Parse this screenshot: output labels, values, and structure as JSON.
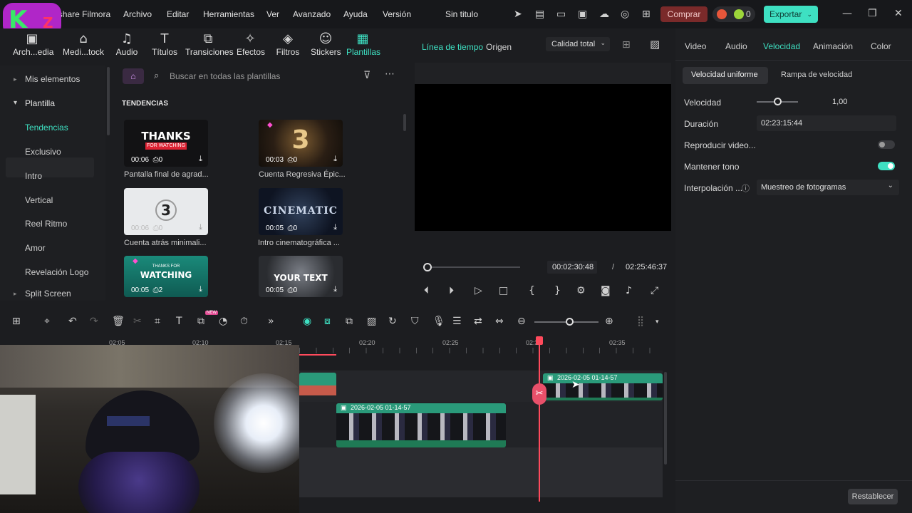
{
  "app": {
    "name": "Wondershare Filmora",
    "project_title": "Sin titulo"
  },
  "menu": [
    "Archivo",
    "Editar",
    "Herramientas",
    "Ver",
    "Avanzado",
    "Ayuda",
    "Versión"
  ],
  "header": {
    "buy_label": "Comprar",
    "credits": "0",
    "export_label": "Exportar"
  },
  "toolbar": [
    {
      "label": "Arch...edia",
      "icon": "media-icon"
    },
    {
      "label": "Medi...tock",
      "icon": "stock-icon"
    },
    {
      "label": "Audio",
      "icon": "audio-icon"
    },
    {
      "label": "Títulos",
      "icon": "titles-icon"
    },
    {
      "label": "Transiciones",
      "icon": "transitions-icon"
    },
    {
      "label": "Efectos",
      "icon": "effects-icon"
    },
    {
      "label": "Filtros",
      "icon": "filters-icon"
    },
    {
      "label": "Stickers",
      "icon": "stickers-icon"
    },
    {
      "label": "Plantillas",
      "icon": "templates-icon"
    }
  ],
  "sidebar": {
    "items": [
      "Mis elementos",
      "Plantilla",
      "Tendencias",
      "Exclusivo",
      "Intro",
      "Vertical",
      "Reel Ritmo",
      "Amor",
      "Revelación Logo",
      "Split Screen"
    ]
  },
  "search": {
    "placeholder": "Buscar en todas las plantillas"
  },
  "section_title": "TENDENCIAS",
  "templates": [
    {
      "caption": "Pantalla final de agrad...",
      "duration": "00:06",
      "count": "0",
      "thumb_text": "THANKS",
      "thumb_sub": "FOR WATCHING"
    },
    {
      "caption": "Cuenta Regresiva Épic...",
      "duration": "00:03",
      "count": "0",
      "thumb_text": "3",
      "thumb_sub": ""
    },
    {
      "caption": "Cuenta atrás minimali...",
      "duration": "00:06",
      "count": "0",
      "thumb_text": "3",
      "thumb_sub": ""
    },
    {
      "caption": "Intro cinematográfica ...",
      "duration": "00:05",
      "count": "0",
      "thumb_text": "CINEMATIC",
      "thumb_sub": ""
    },
    {
      "caption": "",
      "duration": "00:05",
      "count": "2",
      "thumb_text": "WATCHING",
      "thumb_sub": "THANKS FOR"
    },
    {
      "caption": "",
      "duration": "00:05",
      "count": "0",
      "thumb_text": "YOUR TEXT",
      "thumb_sub": ""
    }
  ],
  "preview": {
    "tab_timeline": "Línea de tiempo",
    "tab_source": "Origen",
    "quality": "Calidad total",
    "current_time": "00:02:30:48",
    "separator": "/",
    "total_time": "02:25:46:37"
  },
  "right_panel": {
    "tabs": [
      "Video",
      "Audio",
      "Velocidad",
      "Animación",
      "Color"
    ],
    "speed_tabs": [
      "Velocidad uniforme",
      "Rampa de velocidad"
    ],
    "speed_label": "Velocidad",
    "speed_value": "1,00",
    "duration_label": "Duración",
    "duration_value": "02:23:15:44",
    "reverse_label": "Reproducir video...",
    "reverse_on": false,
    "keep_pitch_label": "Mantener tono",
    "keep_pitch_on": true,
    "interp_label": "Interpolación ...",
    "interp_value": "Muestreo de fotogramas",
    "reset_label": "Restablecer"
  },
  "timeline": {
    "ruler": [
      "02:05",
      "02:10",
      "02:15",
      "02:20",
      "02:25",
      "02:30",
      "02:35"
    ],
    "clips": [
      {
        "name": "2026-02-05 01-14-57"
      },
      {
        "name": "2026-02-05 01-14-57"
      }
    ],
    "badge_new": "NEW"
  },
  "colors": {
    "accent": "#3ee0c2",
    "playhead": "#ff4a5c",
    "buy": "#7a2a2a"
  }
}
